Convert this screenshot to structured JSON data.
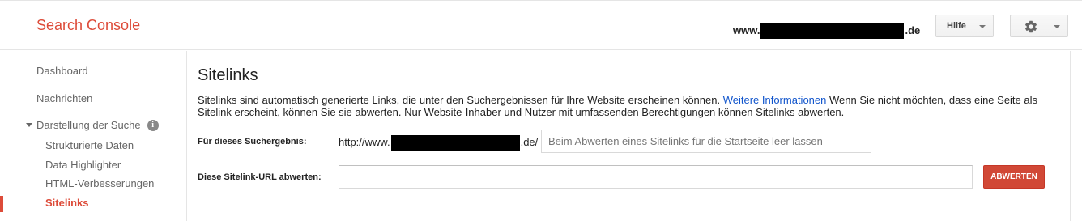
{
  "app": {
    "title": "Search Console"
  },
  "header": {
    "site_prefix": "www.",
    "site_suffix": ".de",
    "help_label": "Hilfe",
    "settings_icon": "gear-icon"
  },
  "sidebar": {
    "items": [
      {
        "label": "Dashboard"
      },
      {
        "label": "Nachrichten"
      },
      {
        "label": "Darstellung der Suche"
      },
      {
        "label": "Strukturierte Daten"
      },
      {
        "label": "Data Highlighter"
      },
      {
        "label": "HTML-Verbesserungen"
      },
      {
        "label": "Sitelinks"
      }
    ],
    "info_glyph": "i",
    "active_item": "Sitelinks",
    "accent_color": "#dd4b39"
  },
  "main": {
    "title": "Sitelinks",
    "description_before": "Sitelinks sind automatisch generierte Links, die unter den Suchergebnissen für Ihre Website erscheinen können. ",
    "description_link": "Weitere Informationen",
    "description_after": " Wenn Sie nicht möchten, dass eine Seite als Sitelink erscheint, können Sie sie abwerten. Nur Website-Inhaber und Nutzer mit umfassenden Berechtigungen können Sitelinks abwerten.",
    "search_result_label": "Für dieses Suchergebnis:",
    "url_prefix": "http://www.",
    "url_suffix": ".de/",
    "search_result_placeholder": "Beim Abwerten eines Sitelinks für die Startseite leer lassen",
    "demote_label": "Diese Sitelink-URL abwerten:",
    "demote_value": "",
    "demote_button": "ABWERTEN",
    "button_color": "#d14836",
    "link_color": "#1155cc"
  }
}
